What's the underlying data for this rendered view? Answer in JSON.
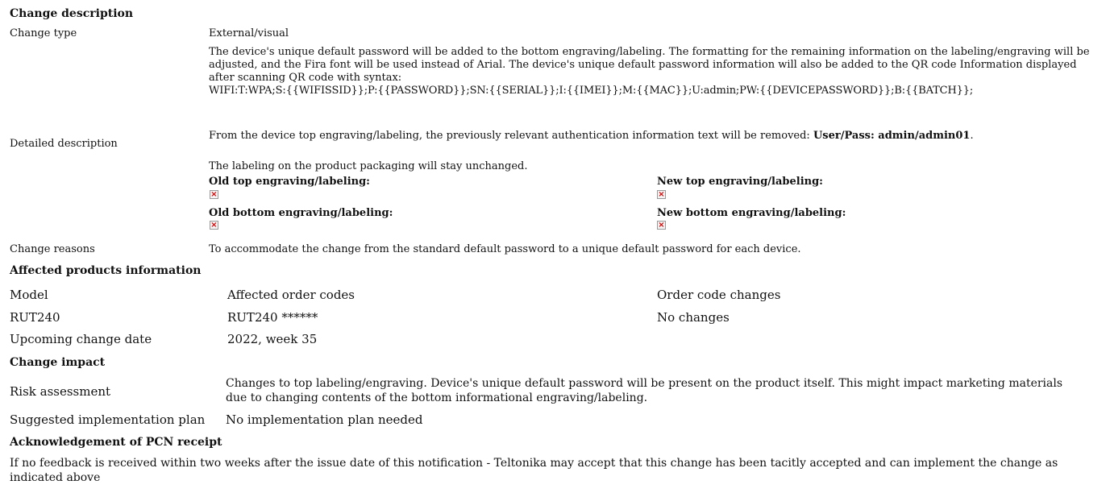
{
  "change_description": {
    "title": "Change description",
    "change_type_label": "Change type",
    "change_type_value": "External/visual",
    "detailed_label": "Detailed description",
    "para1": "The device's unique default password will be added to the bottom engraving/labeling. The formatting for the remaining information on the labeling/engraving will be adjusted, and the Fira font will be used instead of Arial. The device's unique default password information will also be added to the QR code Information displayed after scanning QR code with syntax:",
    "syntax": "WIFI:T:WPA;S:{{WIFISSID}};P:{{PASSWORD}};SN:{{SERIAL}};I:{{IMEI}};M:{{MAC}};U:admin;PW:{{DEVICEPASSWORD}};B:{{BATCH}};",
    "para2_text": "From the device top engraving/labeling, the previously relevant authentication information text will be removed: ",
    "para2_bold": "User/Pass: admin/admin01",
    "para2_end": ".",
    "para3": "The labeling on the product packaging will stay unchanged.",
    "old_top": "Old top engraving/labeling:",
    "new_top": "New top engraving/labeling:",
    "old_bottom": "Old bottom engraving/labeling:",
    "new_bottom": "New bottom engraving/labeling:",
    "broken_image_glyph": "×",
    "reasons_label": "Change reasons",
    "reasons_value": "To accommodate the change from the standard default password to a unique default password for each device."
  },
  "affected": {
    "title": "Affected products information",
    "headers": [
      "Model",
      "Affected order codes",
      "Order code changes"
    ],
    "row": [
      "RUT240",
      "RUT240 ******",
      "No changes"
    ],
    "date_label": "Upcoming change date",
    "date_value": "2022, week 35"
  },
  "impact": {
    "title": "Change impact",
    "risk_label": "Risk assessment",
    "risk_value": "Changes to top labeling/engraving. Device's unique default password will be present on the product itself. This might impact marketing materials due to changing contents of the bottom informational engraving/labeling.",
    "plan_label": "Suggested implementation plan",
    "plan_value": "No implementation plan needed"
  },
  "ack": {
    "title": "Acknowledgement of PCN receipt",
    "text": "If no feedback is received within two weeks after the issue date of this notification - Teltonika may accept that this change has been tacitly accepted and can implement the change as indicated above"
  }
}
